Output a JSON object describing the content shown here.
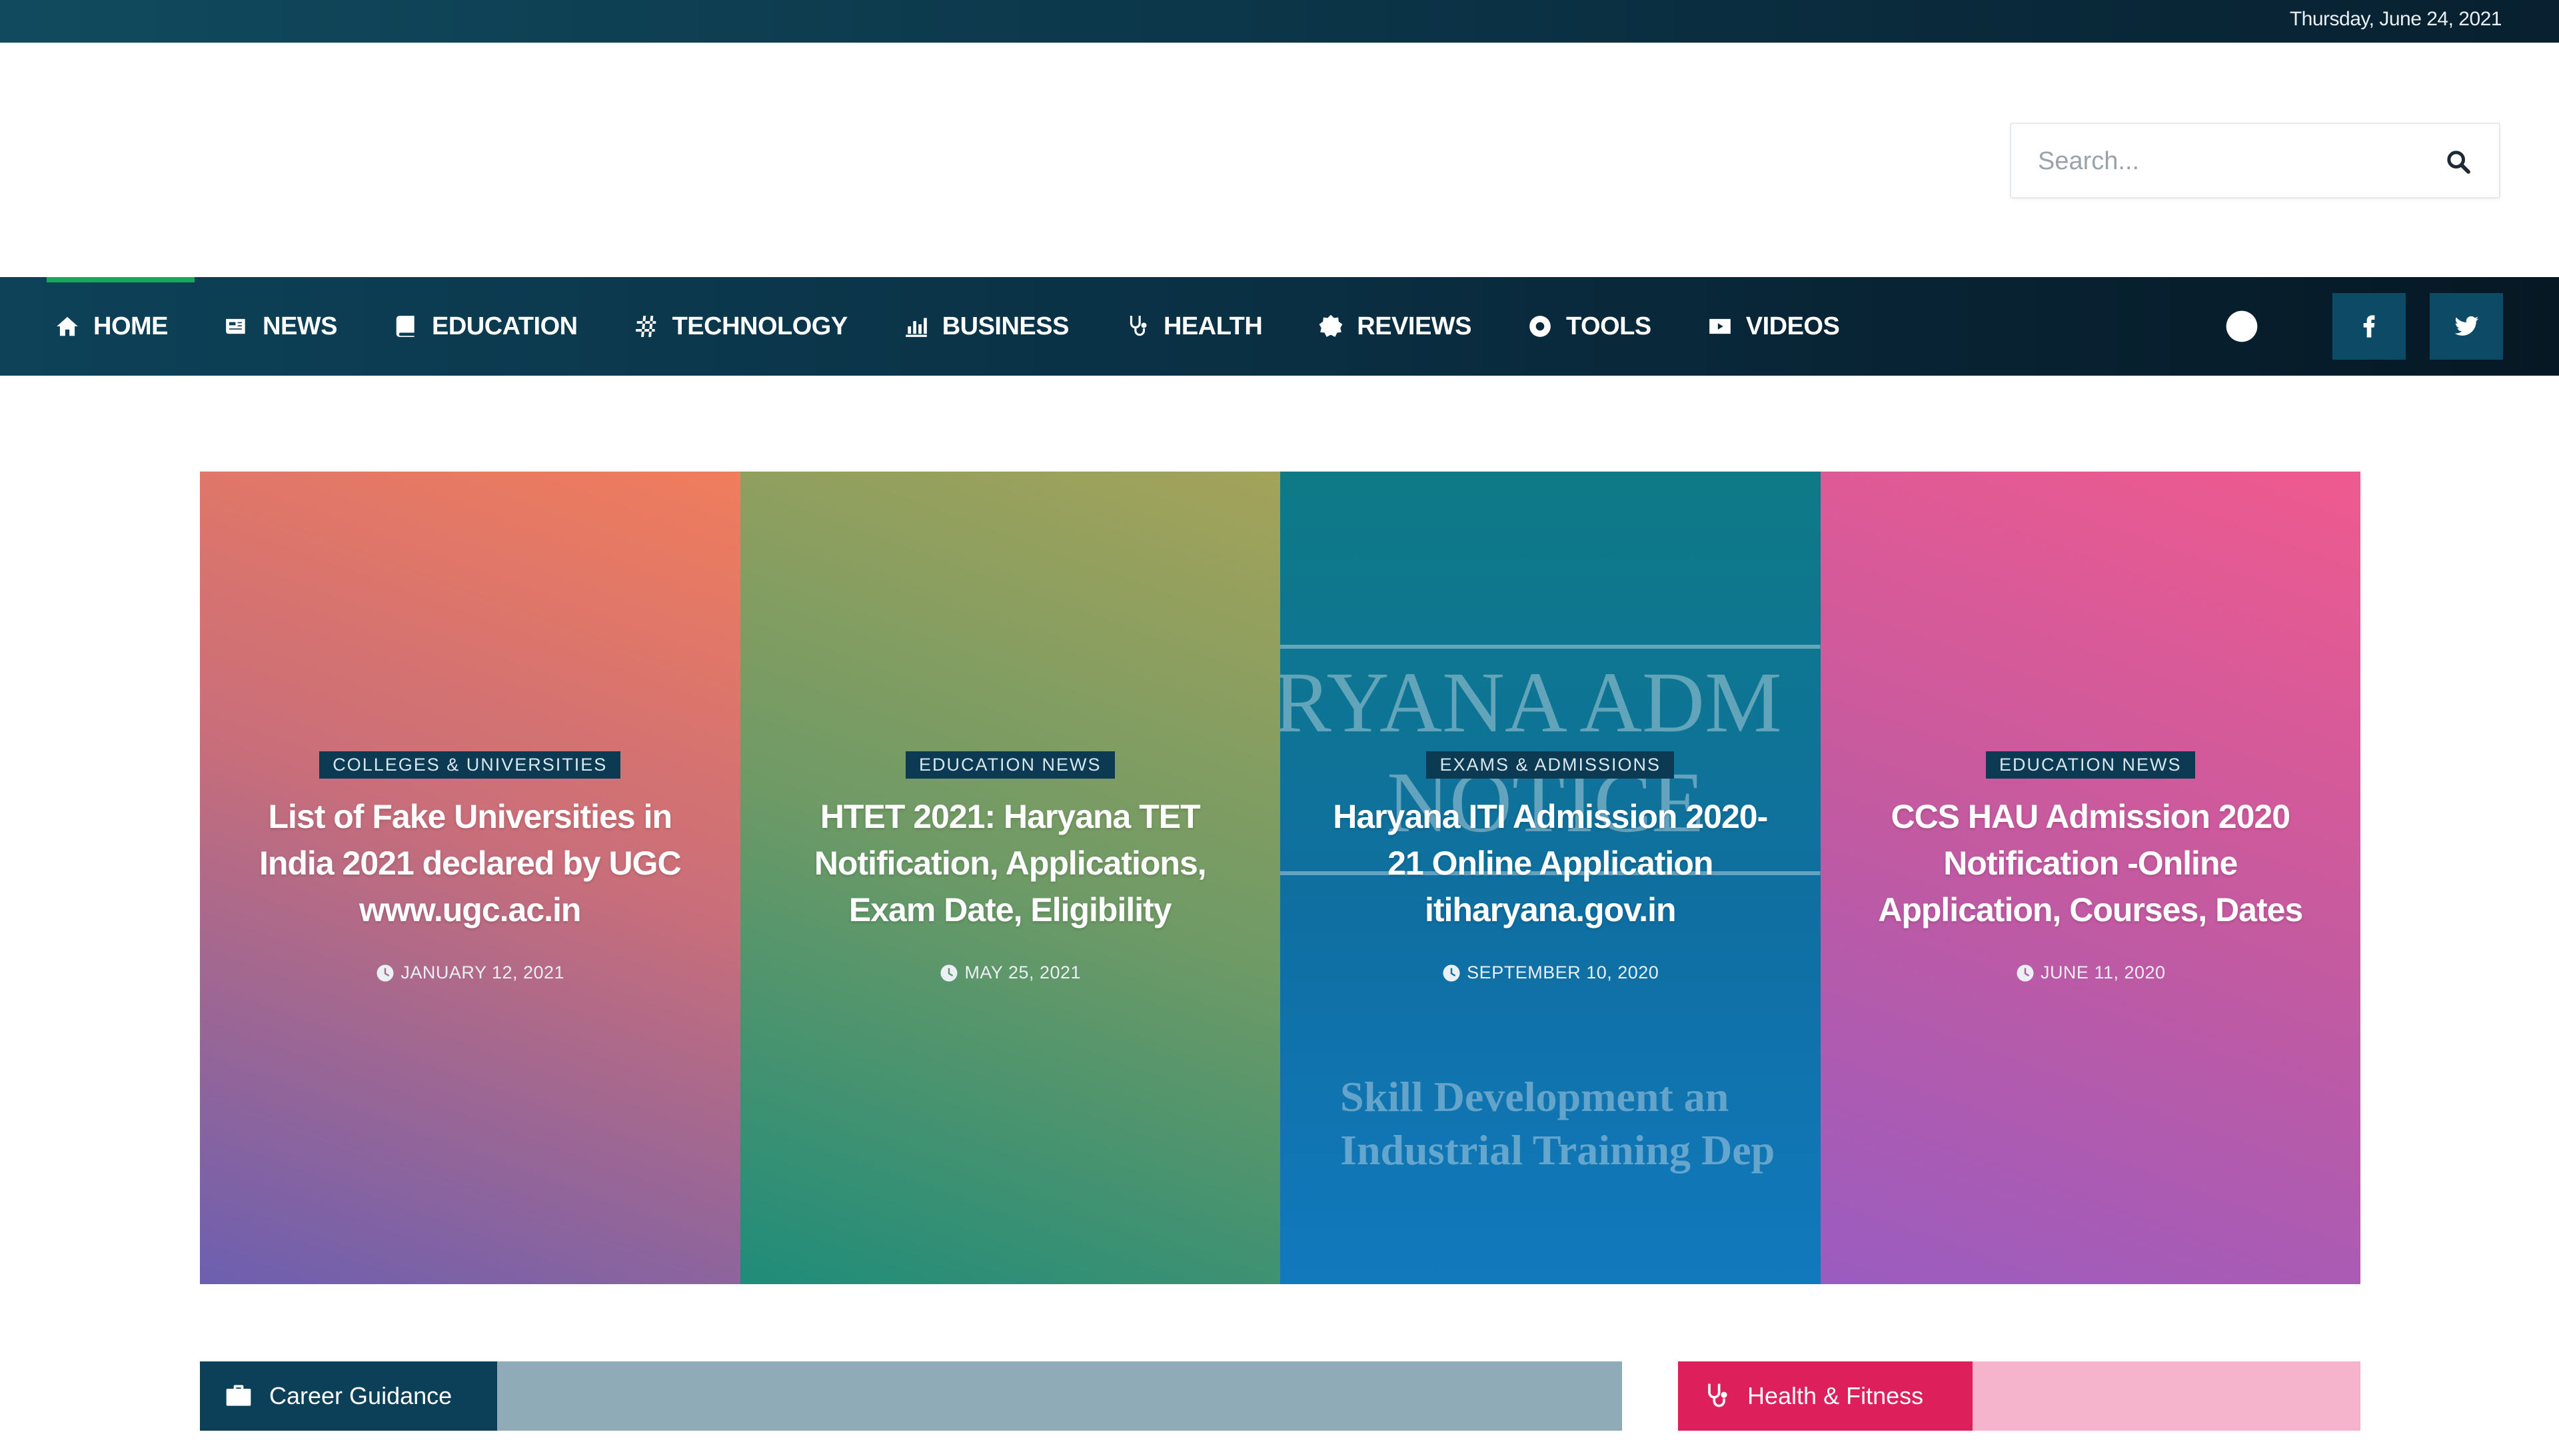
{
  "topbar": {
    "date": "Thursday, June 24, 2021"
  },
  "search": {
    "placeholder": "Search..."
  },
  "nav": {
    "items": [
      {
        "label": "HOME",
        "icon": "home-icon"
      },
      {
        "label": "NEWS",
        "icon": "newspaper-icon"
      },
      {
        "label": "EDUCATION",
        "icon": "book-icon"
      },
      {
        "label": "TECHNOLOGY",
        "icon": "hashtag-icon"
      },
      {
        "label": "BUSINESS",
        "icon": "bar-chart-icon"
      },
      {
        "label": "HEALTH",
        "icon": "stethoscope-icon"
      },
      {
        "label": "REVIEWS",
        "icon": "badge-icon"
      },
      {
        "label": "TOOLS",
        "icon": "gear-icon"
      },
      {
        "label": "VIDEOS",
        "icon": "video-icon"
      }
    ],
    "active_index": 0,
    "social": [
      "facebook-icon",
      "twitter-icon"
    ]
  },
  "cards": [
    {
      "category": "COLLEGES & UNIVERSITIES",
      "title": "List of Fake Universities in India 2021 declared by UGC www.ugc.ac.in",
      "date": "JANUARY 12, 2021"
    },
    {
      "category": "EDUCATION NEWS",
      "title": "HTET 2021: Haryana TET Notification, Applications, Exam Date, Eligibility",
      "date": "MAY 25, 2021"
    },
    {
      "category": "EXAMS & ADMISSIONS",
      "title": "Haryana ITI Admission 2020-21 Online Application itiharyana.gov.in",
      "date": "SEPTEMBER 10, 2020",
      "bg_text_1": "RYANA ADM",
      "bg_text_2": "NOTICE",
      "bg_text_3": "Skill Development an",
      "bg_text_4": "Industrial Training Dep"
    },
    {
      "category": "EDUCATION NEWS",
      "title": "CCS HAU Admission 2020 Notification -Online Application, Courses, Dates",
      "date": "JUNE 11, 2020"
    }
  ],
  "sections": {
    "career": {
      "label": "Career Guidance",
      "color": "#0c4059"
    },
    "health": {
      "label": "Health & Fitness",
      "color": "#dd1f5b"
    }
  }
}
